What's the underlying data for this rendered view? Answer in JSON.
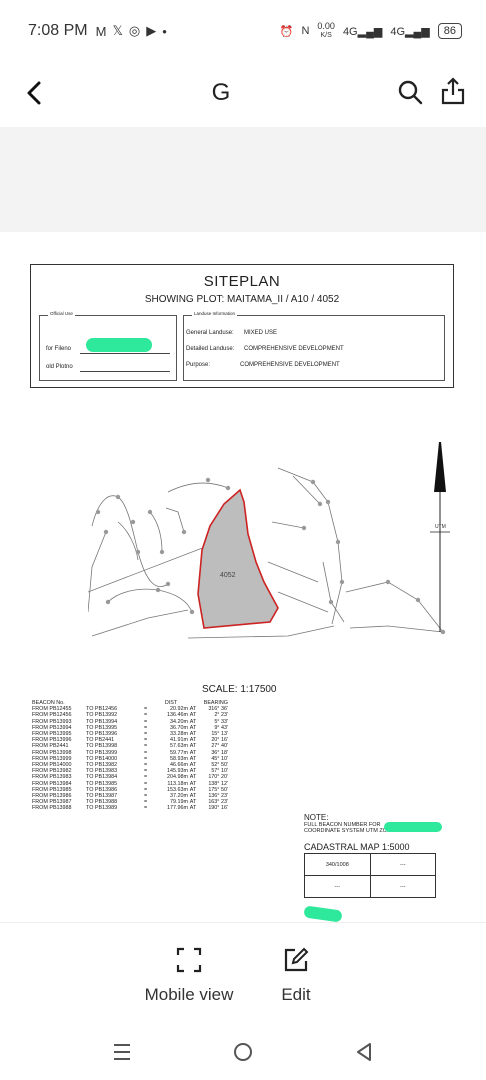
{
  "status_bar": {
    "time": "7:08 PM",
    "notification_icons": [
      "mail-icon",
      "x-icon",
      "instagram-icon",
      "youtube-icon",
      "dot-icon"
    ],
    "net_speed": "0.00",
    "net_unit": "K/S",
    "signal1": "4G",
    "signal2": "4G",
    "battery": "86"
  },
  "app_bar": {
    "title": "G"
  },
  "document": {
    "siteplan_title": "SITEPLAN",
    "siteplan_subtitle": "SHOWING PLOT: MAITAMA_II / A10 / 4052",
    "official_use_legend": "Official Use",
    "landuse_legend": "Landuse Information",
    "for_fileno_label": "for Fileno",
    "old_plotno_label": "old Plotno",
    "general_landuse_label": "General Landuse:",
    "general_landuse_value": "MIXED USE",
    "detailed_landuse_label": "Detailed Landuse:",
    "detailed_landuse_value": "COMPREHENSIVE DEVELOPMENT",
    "purpose_label": "Purpose:",
    "purpose_value": "COMPREHENSIVE DEVELOPMENT",
    "plot_number": "4052",
    "utm_label": "UTM",
    "scale": "SCALE: 1:17500",
    "beacon_header": {
      "col1": "BEACON No.",
      "dist": "DIST",
      "bearing": "BEARING"
    },
    "beacon_rows": [
      {
        "from": "FROM PB12455",
        "to": "TO PB12456",
        "dist": "20.92m",
        "bearing": "316° 36'"
      },
      {
        "from": "FROM PB12456",
        "to": "TO PB13992",
        "dist": "136.46m",
        "bearing": "2° 23'"
      },
      {
        "from": "FROM PB13993",
        "to": "TO PB13994",
        "dist": "34.20m",
        "bearing": "5° 33'"
      },
      {
        "from": "FROM PB13994",
        "to": "TO PB13995",
        "dist": "36.70m",
        "bearing": "9° 43'"
      },
      {
        "from": "FROM PB13995",
        "to": "TO PB13996",
        "dist": "33.28m",
        "bearing": "15° 13'"
      },
      {
        "from": "FROM PB13996",
        "to": "TO PB2441",
        "dist": "41.91m",
        "bearing": "20° 16'"
      },
      {
        "from": "FROM PB2441",
        "to": "TO PB13998",
        "dist": "57.63m",
        "bearing": "27° 40'"
      },
      {
        "from": "FROM PB13998",
        "to": "TO PB13999",
        "dist": "59.77m",
        "bearing": "36° 18'"
      },
      {
        "from": "FROM PB13999",
        "to": "TO PB14000",
        "dist": "58.93m",
        "bearing": "45° 10'"
      },
      {
        "from": "FROM PB14000",
        "to": "TO PB13982",
        "dist": "46.66m",
        "bearing": "52° 50'"
      },
      {
        "from": "FROM PB13982",
        "to": "TO PB13983",
        "dist": "145.93m",
        "bearing": "57° 10'"
      },
      {
        "from": "FROM PB13983",
        "to": "TO PB13984",
        "dist": "204.98m",
        "bearing": "170° 20'"
      },
      {
        "from": "FROM PB13984",
        "to": "TO PB13985",
        "dist": "113.18m",
        "bearing": "138° 12'"
      },
      {
        "from": "FROM PB13985",
        "to": "TO PB13986",
        "dist": "153.63m",
        "bearing": "175° 50'"
      },
      {
        "from": "FROM PB13986",
        "to": "TO PB13987",
        "dist": "37.20m",
        "bearing": "136° 23'"
      },
      {
        "from": "FROM PB13987",
        "to": "TO PB13988",
        "dist": "79.19m",
        "bearing": "163° 23'"
      },
      {
        "from": "FROM PB13988",
        "to": "TO PB13989",
        "dist": "177.96m",
        "bearing": "190° 16'"
      }
    ],
    "note_title": "NOTE:",
    "note_line1": "FULL BEACON NUMBER FOR",
    "note_line2": "COORDINATE SYSTEM UTM ZONE 32N",
    "cadastral_title": "CADASTRAL MAP 1:5000",
    "cadastral_cells": [
      "340/1008",
      "---",
      "---",
      "---"
    ]
  },
  "bottom_toolbar": {
    "mobile_view_label": "Mobile view",
    "edit_label": "Edit"
  },
  "nav_bar": {
    "recents_icon": "menu-lines-icon",
    "home_icon": "circle-home-icon",
    "back_icon": "triangle-back-icon"
  },
  "colors": {
    "highlight": "#2ee89c",
    "plot_fill": "#bdbdbd",
    "plot_boundary": "#cc2222"
  }
}
